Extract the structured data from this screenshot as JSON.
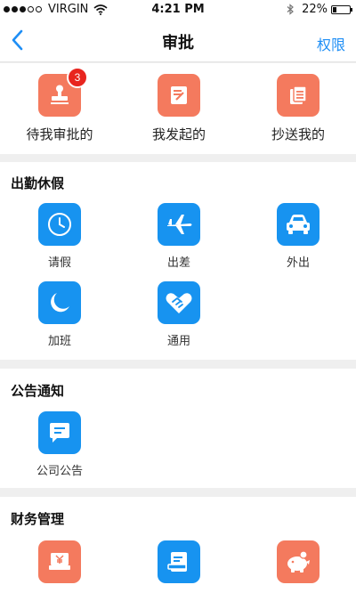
{
  "status_bar": {
    "carrier": "VIRGIN",
    "time": "4:21 PM",
    "battery": "22%",
    "battery_level": 0.22
  },
  "nav": {
    "title": "审批",
    "right_action": "权限"
  },
  "top_actions": [
    {
      "label": "待我审批的",
      "badge": "3",
      "icon": "stamp-icon"
    },
    {
      "label": "我发起的",
      "icon": "edit-document-icon"
    },
    {
      "label": "抄送我的",
      "icon": "copy-documents-icon"
    }
  ],
  "attendance": {
    "title": "出勤休假",
    "items": [
      {
        "label": "请假",
        "icon": "clock-icon"
      },
      {
        "label": "出差",
        "icon": "airplane-icon"
      },
      {
        "label": "外出",
        "icon": "car-icon"
      },
      {
        "label": "加班",
        "icon": "moon-icon"
      },
      {
        "label": "通用",
        "icon": "handshake-icon"
      }
    ]
  },
  "notice": {
    "title": "公告通知",
    "items": [
      {
        "label": "公司公告",
        "icon": "chat-bubble-icon"
      }
    ]
  },
  "finance": {
    "title": "财务管理",
    "items": [
      {
        "icon": "yuan-wallet-icon"
      },
      {
        "icon": "payment-card-icon"
      },
      {
        "icon": "piggy-bank-icon"
      }
    ]
  },
  "colors": {
    "accent_blue": "#1793f0",
    "accent_orange": "#f47a5e",
    "link_blue": "#1e8ef5",
    "badge_red": "#e8251f"
  }
}
